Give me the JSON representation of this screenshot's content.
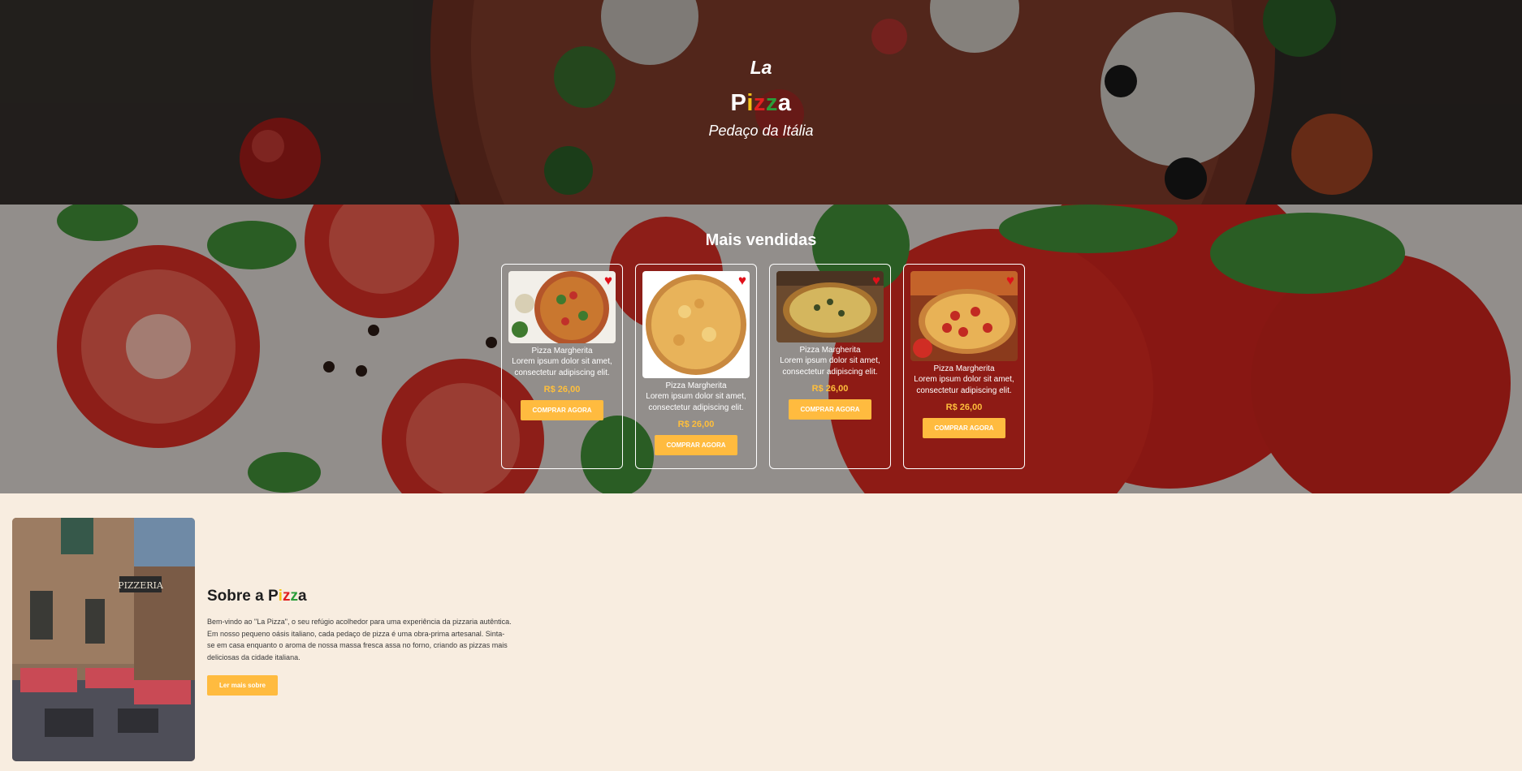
{
  "hero": {
    "la": "La",
    "pizza_letters": [
      "P",
      "i",
      "z",
      "z",
      "a"
    ],
    "pizza_colors": [
      "#ffffff",
      "#f5c518",
      "#e02020",
      "#2a9d3a",
      "#ffffff"
    ],
    "subtitle": "Pedaço da Itália"
  },
  "best_sellers": {
    "title": "Mais vendidas",
    "cards": [
      {
        "name": "Pizza Margherita",
        "desc": "Lorem ipsum dolor sit amet, consectetur adipiscing elit.",
        "price": "R$ 26,00",
        "button": "COMPRAR AGORA",
        "heart": "heart-icon"
      },
      {
        "name": "Pizza Margherita",
        "desc": "Lorem ipsum dolor sit amet, consectetur adipiscing elit.",
        "price": "R$ 26,00",
        "button": "COMPRAR AGORA",
        "heart": "heart-icon"
      },
      {
        "name": "Pizza Margherita",
        "desc": "Lorem ipsum dolor sit amet, consectetur adipiscing elit.",
        "price": "R$ 26,00",
        "button": "COMPRAR AGORA",
        "heart": "heart-icon"
      },
      {
        "name": "Pizza Margherita",
        "desc": "Lorem ipsum dolor sit amet, consectetur adipiscing elit.",
        "price": "R$ 26,00",
        "button": "COMPRAR AGORA",
        "heart": "heart-icon"
      }
    ]
  },
  "about": {
    "title_prefix": "Sobre a ",
    "title_letters": [
      "P",
      "i",
      "z",
      "z",
      "a"
    ],
    "title_colors": [
      "#1e1e1e",
      "#f5c518",
      "#e02020",
      "#2a9d3a",
      "#1e1e1e"
    ],
    "text": "Bem-vindo ao \"La Pizza\", o seu refúgio acolhedor para uma experiência da pizzaria autêntica. Em nosso pequeno oásis italiano, cada pedaço de pizza é uma obra-prima artesanal. Sinta-se em casa enquanto o aroma de nossa massa fresca assa no forno, criando as pizzas mais deliciosas da cidade italiana.",
    "button": "Ler mais sobre",
    "image_sign": "PIZZERIA"
  },
  "colors": {
    "accent": "#ffbb3f",
    "price": "#ffbf3b",
    "heart": "#e0101a",
    "about_bg": "#f8ede0"
  }
}
